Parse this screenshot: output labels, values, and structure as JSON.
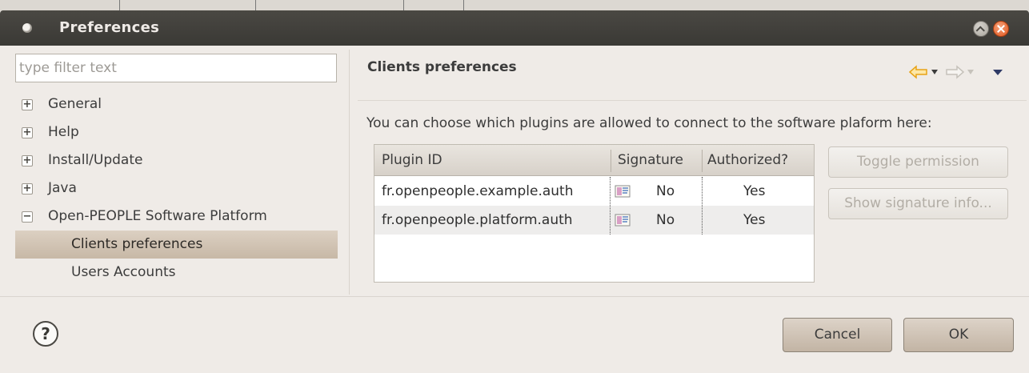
{
  "background_tabs": [
    "",
    "",
    "",
    ""
  ],
  "window": {
    "title": "Preferences"
  },
  "filter": {
    "placeholder": "type filter text",
    "value": ""
  },
  "tree": [
    {
      "label": "General",
      "expander": "+",
      "depth": 0
    },
    {
      "label": "Help",
      "expander": "+",
      "depth": 0
    },
    {
      "label": "Install/Update",
      "expander": "+",
      "depth": 0
    },
    {
      "label": "Java",
      "expander": "+",
      "depth": 0
    },
    {
      "label": "Open-PEOPLE Software Platform",
      "expander": "−",
      "depth": 0
    },
    {
      "label": "Clients preferences",
      "depth": 1,
      "selected": true
    },
    {
      "label": "Users Accounts",
      "depth": 1
    }
  ],
  "page": {
    "title": "Clients preferences",
    "description": "You can choose which plugins are allowed to connect to the  software plaform here:"
  },
  "nav": {
    "back_icon": "back-arrow-icon",
    "forward_icon": "forward-arrow-icon",
    "menu_icon": "view-menu-icon",
    "active_color": "#e8a317"
  },
  "table": {
    "headers": [
      "Plugin ID",
      "Signature",
      "Authorized?"
    ],
    "rows": [
      {
        "plugin_id": "fr.openpeople.example.auth",
        "signature_icon": "certificate-icon",
        "signature": "No",
        "authorized": "Yes"
      },
      {
        "plugin_id": "fr.openpeople.platform.auth",
        "signature_icon": "certificate-icon",
        "signature": "No",
        "authorized": "Yes"
      }
    ]
  },
  "buttons": {
    "toggle_permission": "Toggle permission",
    "show_signature_info": "Show signature info...",
    "cancel": "Cancel",
    "ok": "OK",
    "help": "?"
  },
  "colors": {
    "titlebar": "#3f3d39",
    "selection": "#cfc2b2",
    "close_button": "#e0561d"
  }
}
